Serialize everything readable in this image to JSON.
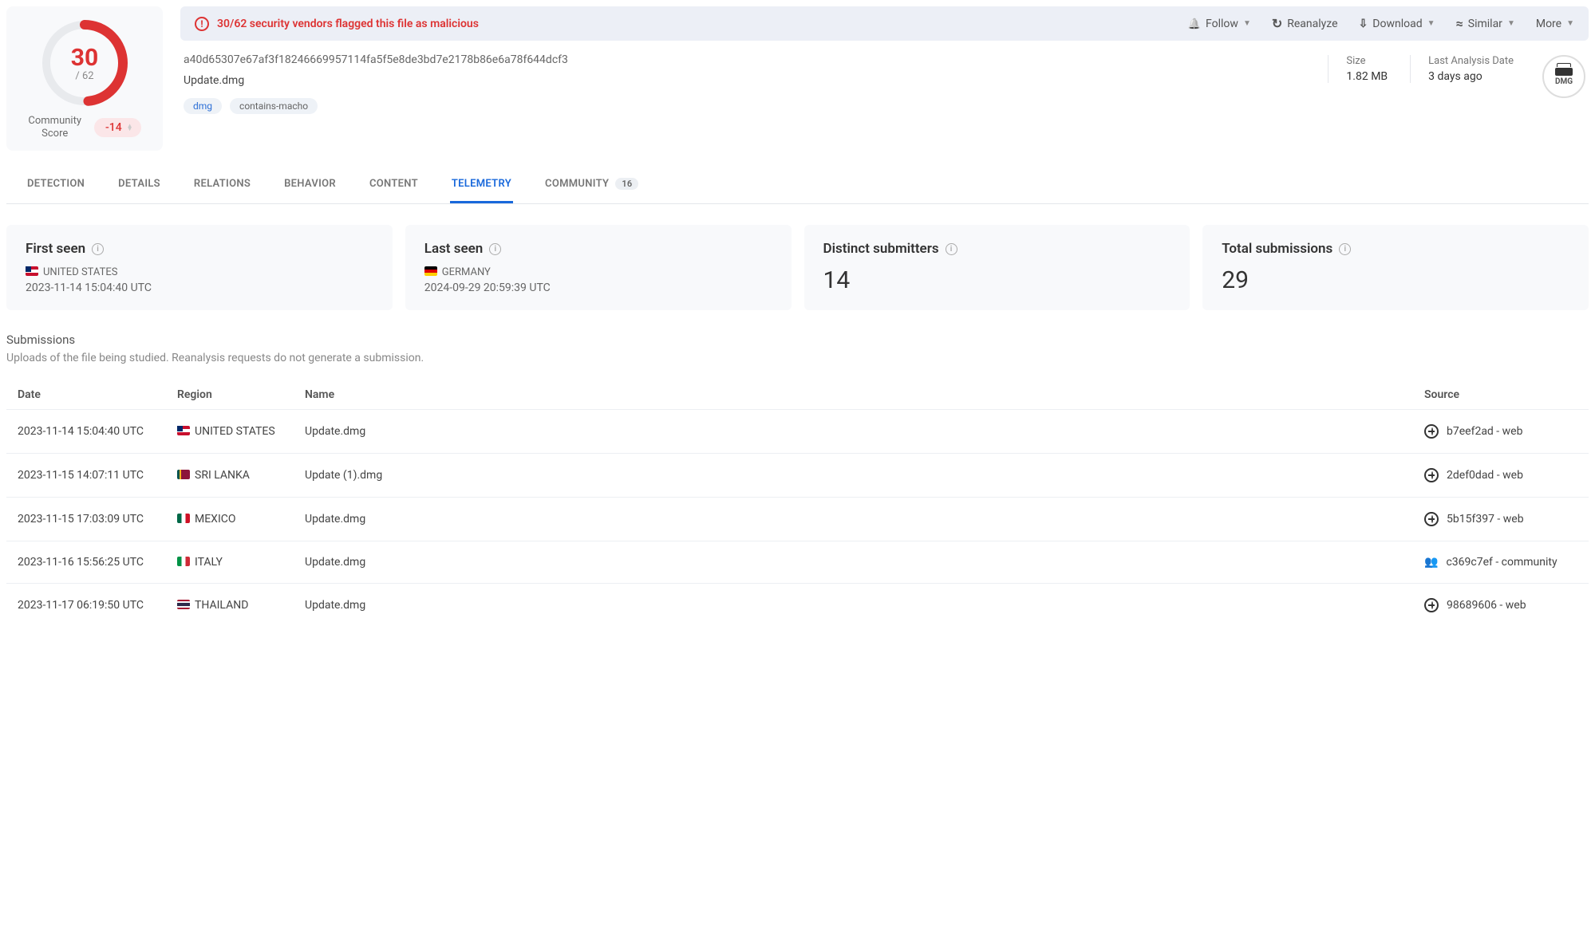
{
  "score": {
    "detected": "30",
    "total": "/ 62"
  },
  "community": {
    "label": "Community\nScore",
    "value": "-14"
  },
  "banner": "30/62 security vendors flagged this file as malicious",
  "actions": {
    "follow": "Follow",
    "reanalyze": "Reanalyze",
    "download": "Download",
    "similar": "Similar",
    "more": "More"
  },
  "file": {
    "hash": "a40d65307e67af3f18246669957114fa5f5e8de3bd7e2178b86e6a78f644dcf3",
    "name": "Update.dmg",
    "tag1": "dmg",
    "tag2": "contains-macho",
    "size_label": "Size",
    "size": "1.82 MB",
    "last_label": "Last Analysis Date",
    "last": "3 days ago",
    "type": "DMG"
  },
  "tabs": {
    "detection": "DETECTION",
    "details": "DETAILS",
    "relations": "RELATIONS",
    "behavior": "BEHAVIOR",
    "content": "CONTENT",
    "telemetry": "TELEMETRY",
    "community": "COMMUNITY",
    "community_count": "16"
  },
  "cards": {
    "first_seen": {
      "title": "First seen",
      "country": "UNITED STATES",
      "time": "2023-11-14 15:04:40 UTC"
    },
    "last_seen": {
      "title": "Last seen",
      "country": "GERMANY",
      "time": "2024-09-29 20:59:39 UTC"
    },
    "submitters": {
      "title": "Distinct submitters",
      "value": "14"
    },
    "submissions": {
      "title": "Total submissions",
      "value": "29"
    }
  },
  "submissions": {
    "title": "Submissions",
    "subtitle": "Uploads of the file being studied. Reanalysis requests do not generate a submission.",
    "cols": {
      "date": "Date",
      "region": "Region",
      "name": "Name",
      "source": "Source"
    },
    "rows": [
      {
        "date": "2023-11-14 15:04:40 UTC",
        "region": "UNITED STATES",
        "flag": "us",
        "name": "Update.dmg",
        "src": "b7eef2ad - web",
        "src_type": "web"
      },
      {
        "date": "2023-11-15 14:07:11 UTC",
        "region": "SRI LANKA",
        "flag": "lk",
        "name": "Update (1).dmg",
        "src": "2def0dad - web",
        "src_type": "web"
      },
      {
        "date": "2023-11-15 17:03:09 UTC",
        "region": "MEXICO",
        "flag": "mx",
        "name": "Update.dmg",
        "src": "5b15f397 - web",
        "src_type": "web"
      },
      {
        "date": "2023-11-16 15:56:25 UTC",
        "region": "ITALY",
        "flag": "it",
        "name": "Update.dmg",
        "src": "c369c7ef - community",
        "src_type": "community"
      },
      {
        "date": "2023-11-17 06:19:50 UTC",
        "region": "THAILAND",
        "flag": "th",
        "name": "Update.dmg",
        "src": "98689606 - web",
        "src_type": "web"
      }
    ]
  }
}
